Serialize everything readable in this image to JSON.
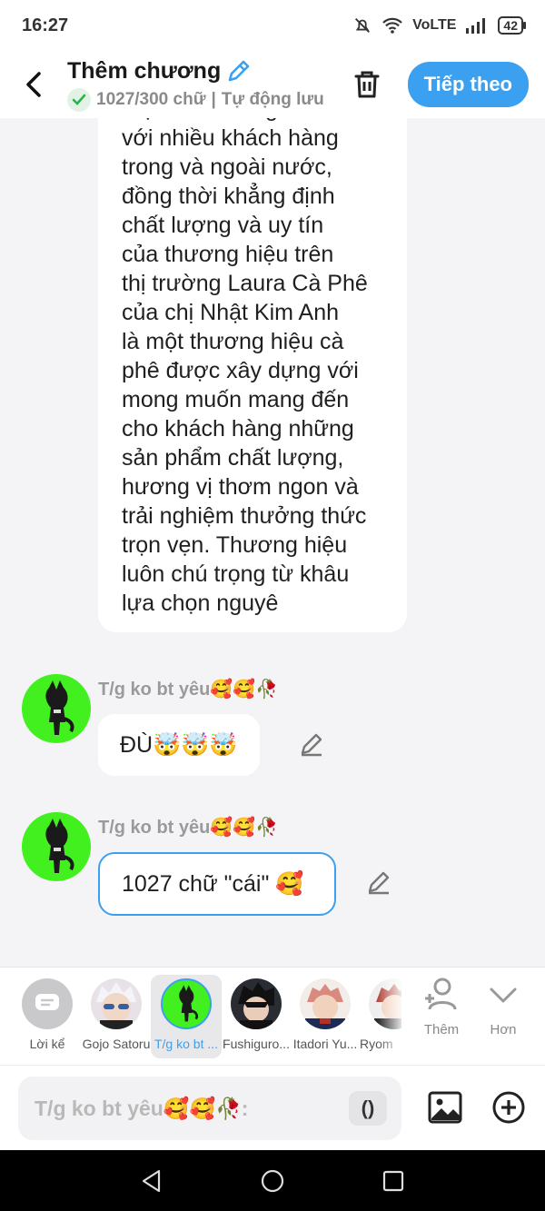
{
  "status_bar": {
    "time": "16:27",
    "network": "VoLTE",
    "battery": "42"
  },
  "header": {
    "title": "Thêm chương",
    "word_count": "1027/300 chữ",
    "autosave": "Tự động lưu",
    "next_label": "Tiếp theo"
  },
  "content": {
    "narration_text": "Việt Nam đến gần hơn\nvới nhiều khách hàng\ntrong và ngoài nước,\nđồng thời khẳng định\nchất lượng và uy tín\ncủa thương hiệu trên\nthị trường Laura Cà Phê\ncủa chị Nhật Kim Anh\nlà một thương hiệu cà\nphê được xây dựng với\nmong muốn mang đến\ncho khách hàng những\nsản phẩm chất lượng,\nhương vị thơm ngon và\ntrải nghiệm thưởng thức\ntrọn vẹn. Thương hiệu\nluôn chú trọng từ khâu\nlựa chọn nguyê",
    "messages": [
      {
        "name": "T/g ko bt yêu🥰🥰🥀",
        "text": "ĐÙ🤯🤯🤯"
      },
      {
        "name": "T/g ko bt yêu🥰🥰🥀",
        "text": "1027 chữ \"cái\" 🥰"
      }
    ]
  },
  "characters": [
    {
      "label": "Lời kể"
    },
    {
      "label": "Gojo Satoru"
    },
    {
      "label": "T/g ko bt ..."
    },
    {
      "label": "Fushiguro..."
    },
    {
      "label": "Itadori Yu..."
    },
    {
      "label": "Ryom"
    }
  ],
  "tools": {
    "add_label": "Thêm",
    "more_label": "Hơn"
  },
  "input": {
    "placeholder": "T/g ko bt yêu🥰🥰🥀:",
    "paren_label": "()"
  },
  "colors": {
    "accent": "#3ca0f0",
    "avatar_green": "#41f01e",
    "check_green": "#2bb24c"
  }
}
